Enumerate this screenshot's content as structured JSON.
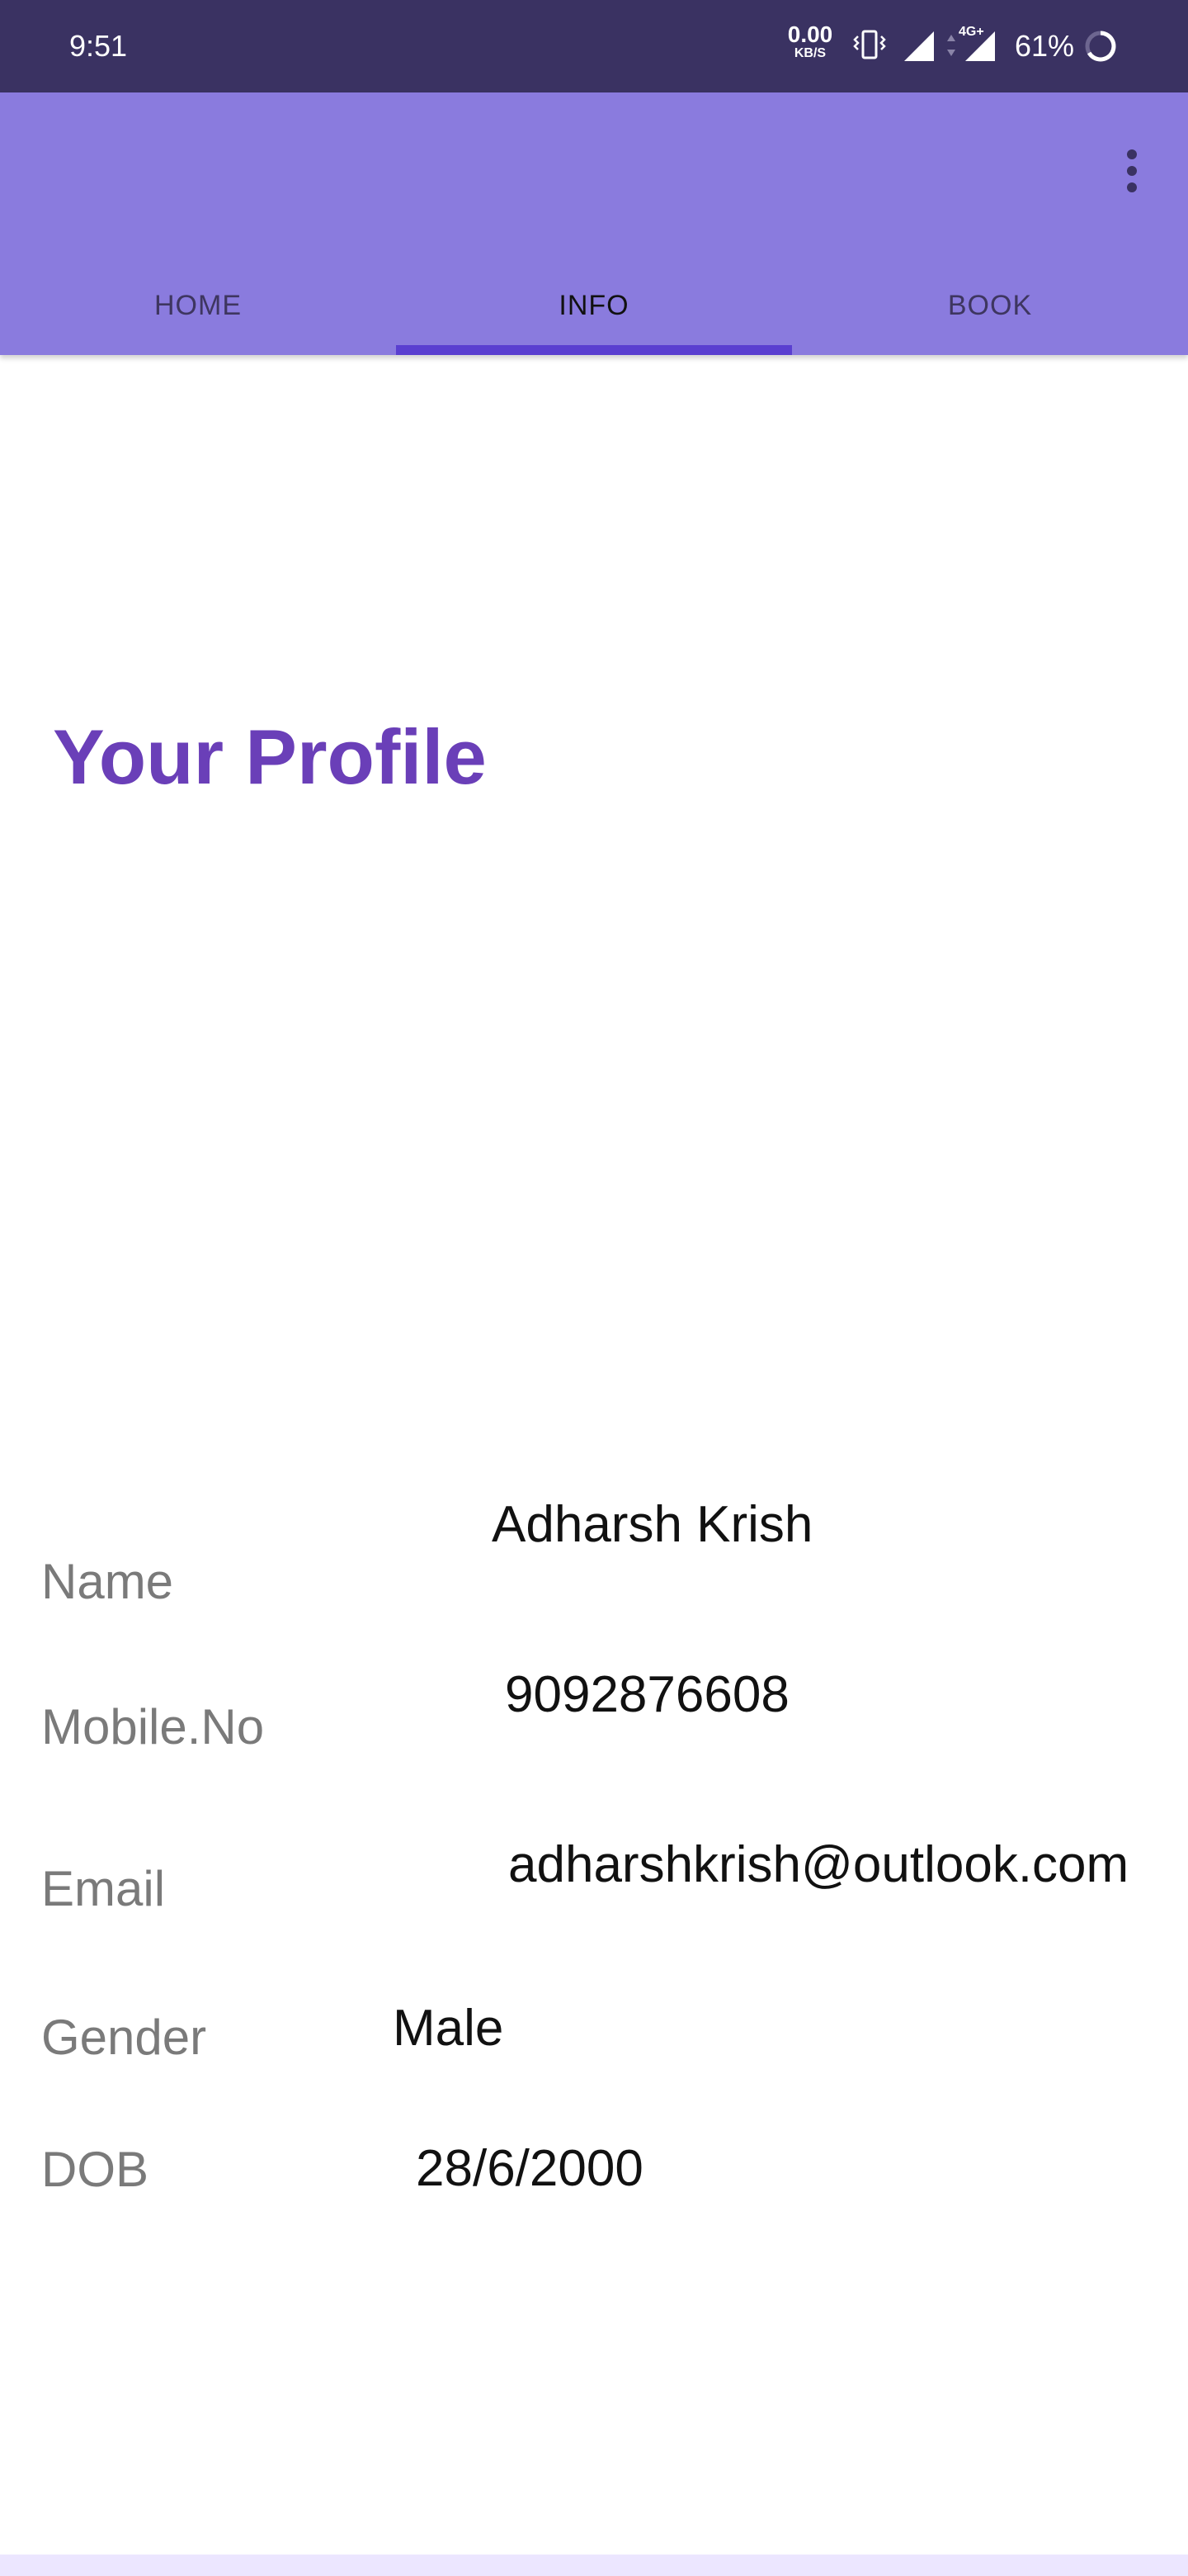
{
  "status_bar": {
    "time": "9:51",
    "net_speed_value": "0.00",
    "net_speed_unit": "KB/S",
    "net_type": "4G+",
    "battery": "61%"
  },
  "app_bar": {
    "tabs": [
      {
        "label": "HOME"
      },
      {
        "label": "INFO"
      },
      {
        "label": "BOOK"
      }
    ],
    "active_tab": "INFO",
    "menu_icon": "more-vert-icon"
  },
  "profile": {
    "title": "Your Profile",
    "fields": [
      {
        "label": "Name",
        "value": "Adharsh Krish"
      },
      {
        "label": "Mobile.No",
        "value": "9092876608"
      },
      {
        "label": "Email",
        "value": "adharshkrish@outlook.com"
      },
      {
        "label": "Gender",
        "value": "Male"
      },
      {
        "label": "DOB",
        "value": "28/6/2000"
      }
    ]
  },
  "colors": {
    "status_bar": "#3a3262",
    "app_bar": "#8a7bde",
    "tab_indicator": "#5a3fd0",
    "title": "#6a3fb8",
    "label": "#7a7a7a",
    "bottom_strip": "#ece6ff"
  }
}
